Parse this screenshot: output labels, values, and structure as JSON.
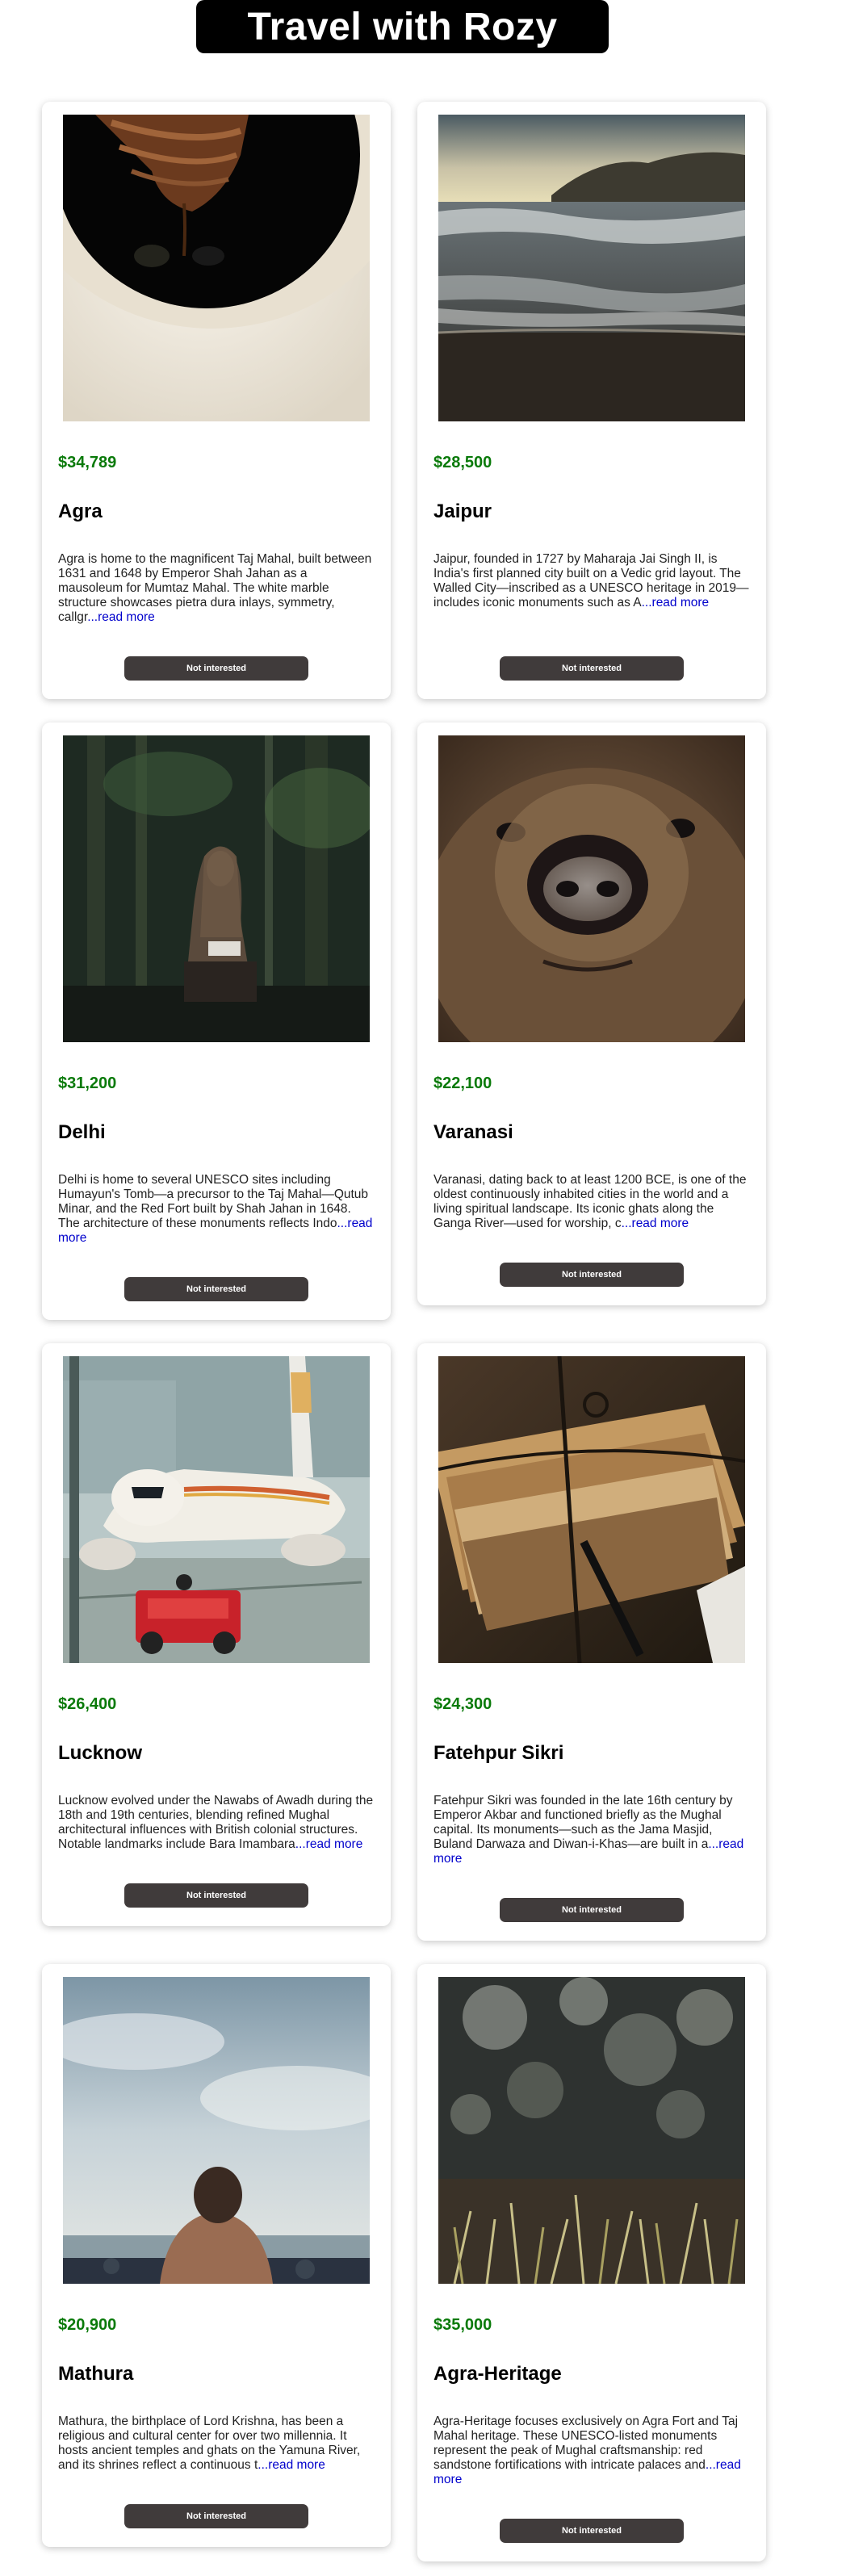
{
  "header": {
    "title": "Travel with Rozy"
  },
  "cards": [
    {
      "price": "$34,789",
      "name": "Agra",
      "description": "Agra is home to the magnificent Taj Mahal, built between 1631 and 1648 by Emperor Shah Jahan as a mausoleum for Mumtaz Mahal. The white marble structure showcases pietra dura inlays, symmetry, callgr",
      "read_more": "...read more",
      "button": "Not interested",
      "image": "coffee-cup-photo"
    },
    {
      "price": "$28,500",
      "name": "Jaipur",
      "description": "Jaipur, founded in 1727 by Maharaja Jai Singh II, is India's first planned city built on a Vedic grid layout. The Walled City—inscribed as a UNESCO heritage in 2019—includes iconic monuments such as A",
      "read_more": "...read more",
      "button": "Not interested",
      "image": "ocean-waves-photo"
    },
    {
      "price": "$31,200",
      "name": "Delhi",
      "description": "Delhi is home to several UNESCO sites including Humayun's Tomb—a precursor to the Taj Mahal—Qutub Minar, and the Red Fort built by Shah Jahan in 1648. The architecture of these monuments reflects Indo",
      "read_more": "...read more",
      "button": "Not interested",
      "image": "woman-in-forest-photo"
    },
    {
      "price": "$22,100",
      "name": "Varanasi",
      "description": "Varanasi, dating back to at least 1200 BCE, is one of the oldest continuously inhabited cities in the world and a living spiritual landscape. Its iconic ghats along the Ganga River—used for worship, c",
      "read_more": "...read more",
      "button": "Not interested",
      "image": "bear-face-photo"
    },
    {
      "price": "$26,400",
      "name": "Lucknow",
      "description": "Lucknow evolved under the Nawabs of Awadh during the 18th and 19th centuries, blending refined Mughal architectural influences with British colonial structures. Notable landmarks include Bara Imambara",
      "read_more": "...read more",
      "button": "Not interested",
      "image": "airplane-photo"
    },
    {
      "price": "$24,300",
      "name": "Fatehpur Sikri",
      "description": "Fatehpur Sikri was founded in the late 16th century by Emperor Akbar and functioned briefly as the Mughal capital. Its monuments—such as the Jama Masjid, Buland Darwaza and Diwan-i-Khas—are built in a",
      "read_more": "...read more",
      "button": "Not interested",
      "image": "tied-books-photo"
    },
    {
      "price": "$20,900",
      "name": "Mathura",
      "description": "Mathura, the birthplace of Lord Krishna, has been a religious and cultural center for over two millennia. It hosts ancient temples and ghats on the Yamuna River, and its shrines reflect a continuous t",
      "read_more": "...read more",
      "button": "Not interested",
      "image": "man-at-sea-photo"
    },
    {
      "price": "$35,000",
      "name": "Agra-Heritage",
      "description": "Agra-Heritage focuses exclusively on Agra Fort and Taj Mahal heritage. These UNESCO-listed monuments represent the peak of Mughal craftsmanship: red sandstone fortifications with intricate palaces and",
      "read_more": "...read more",
      "button": "Not interested",
      "image": "grass-bokeh-photo"
    }
  ]
}
